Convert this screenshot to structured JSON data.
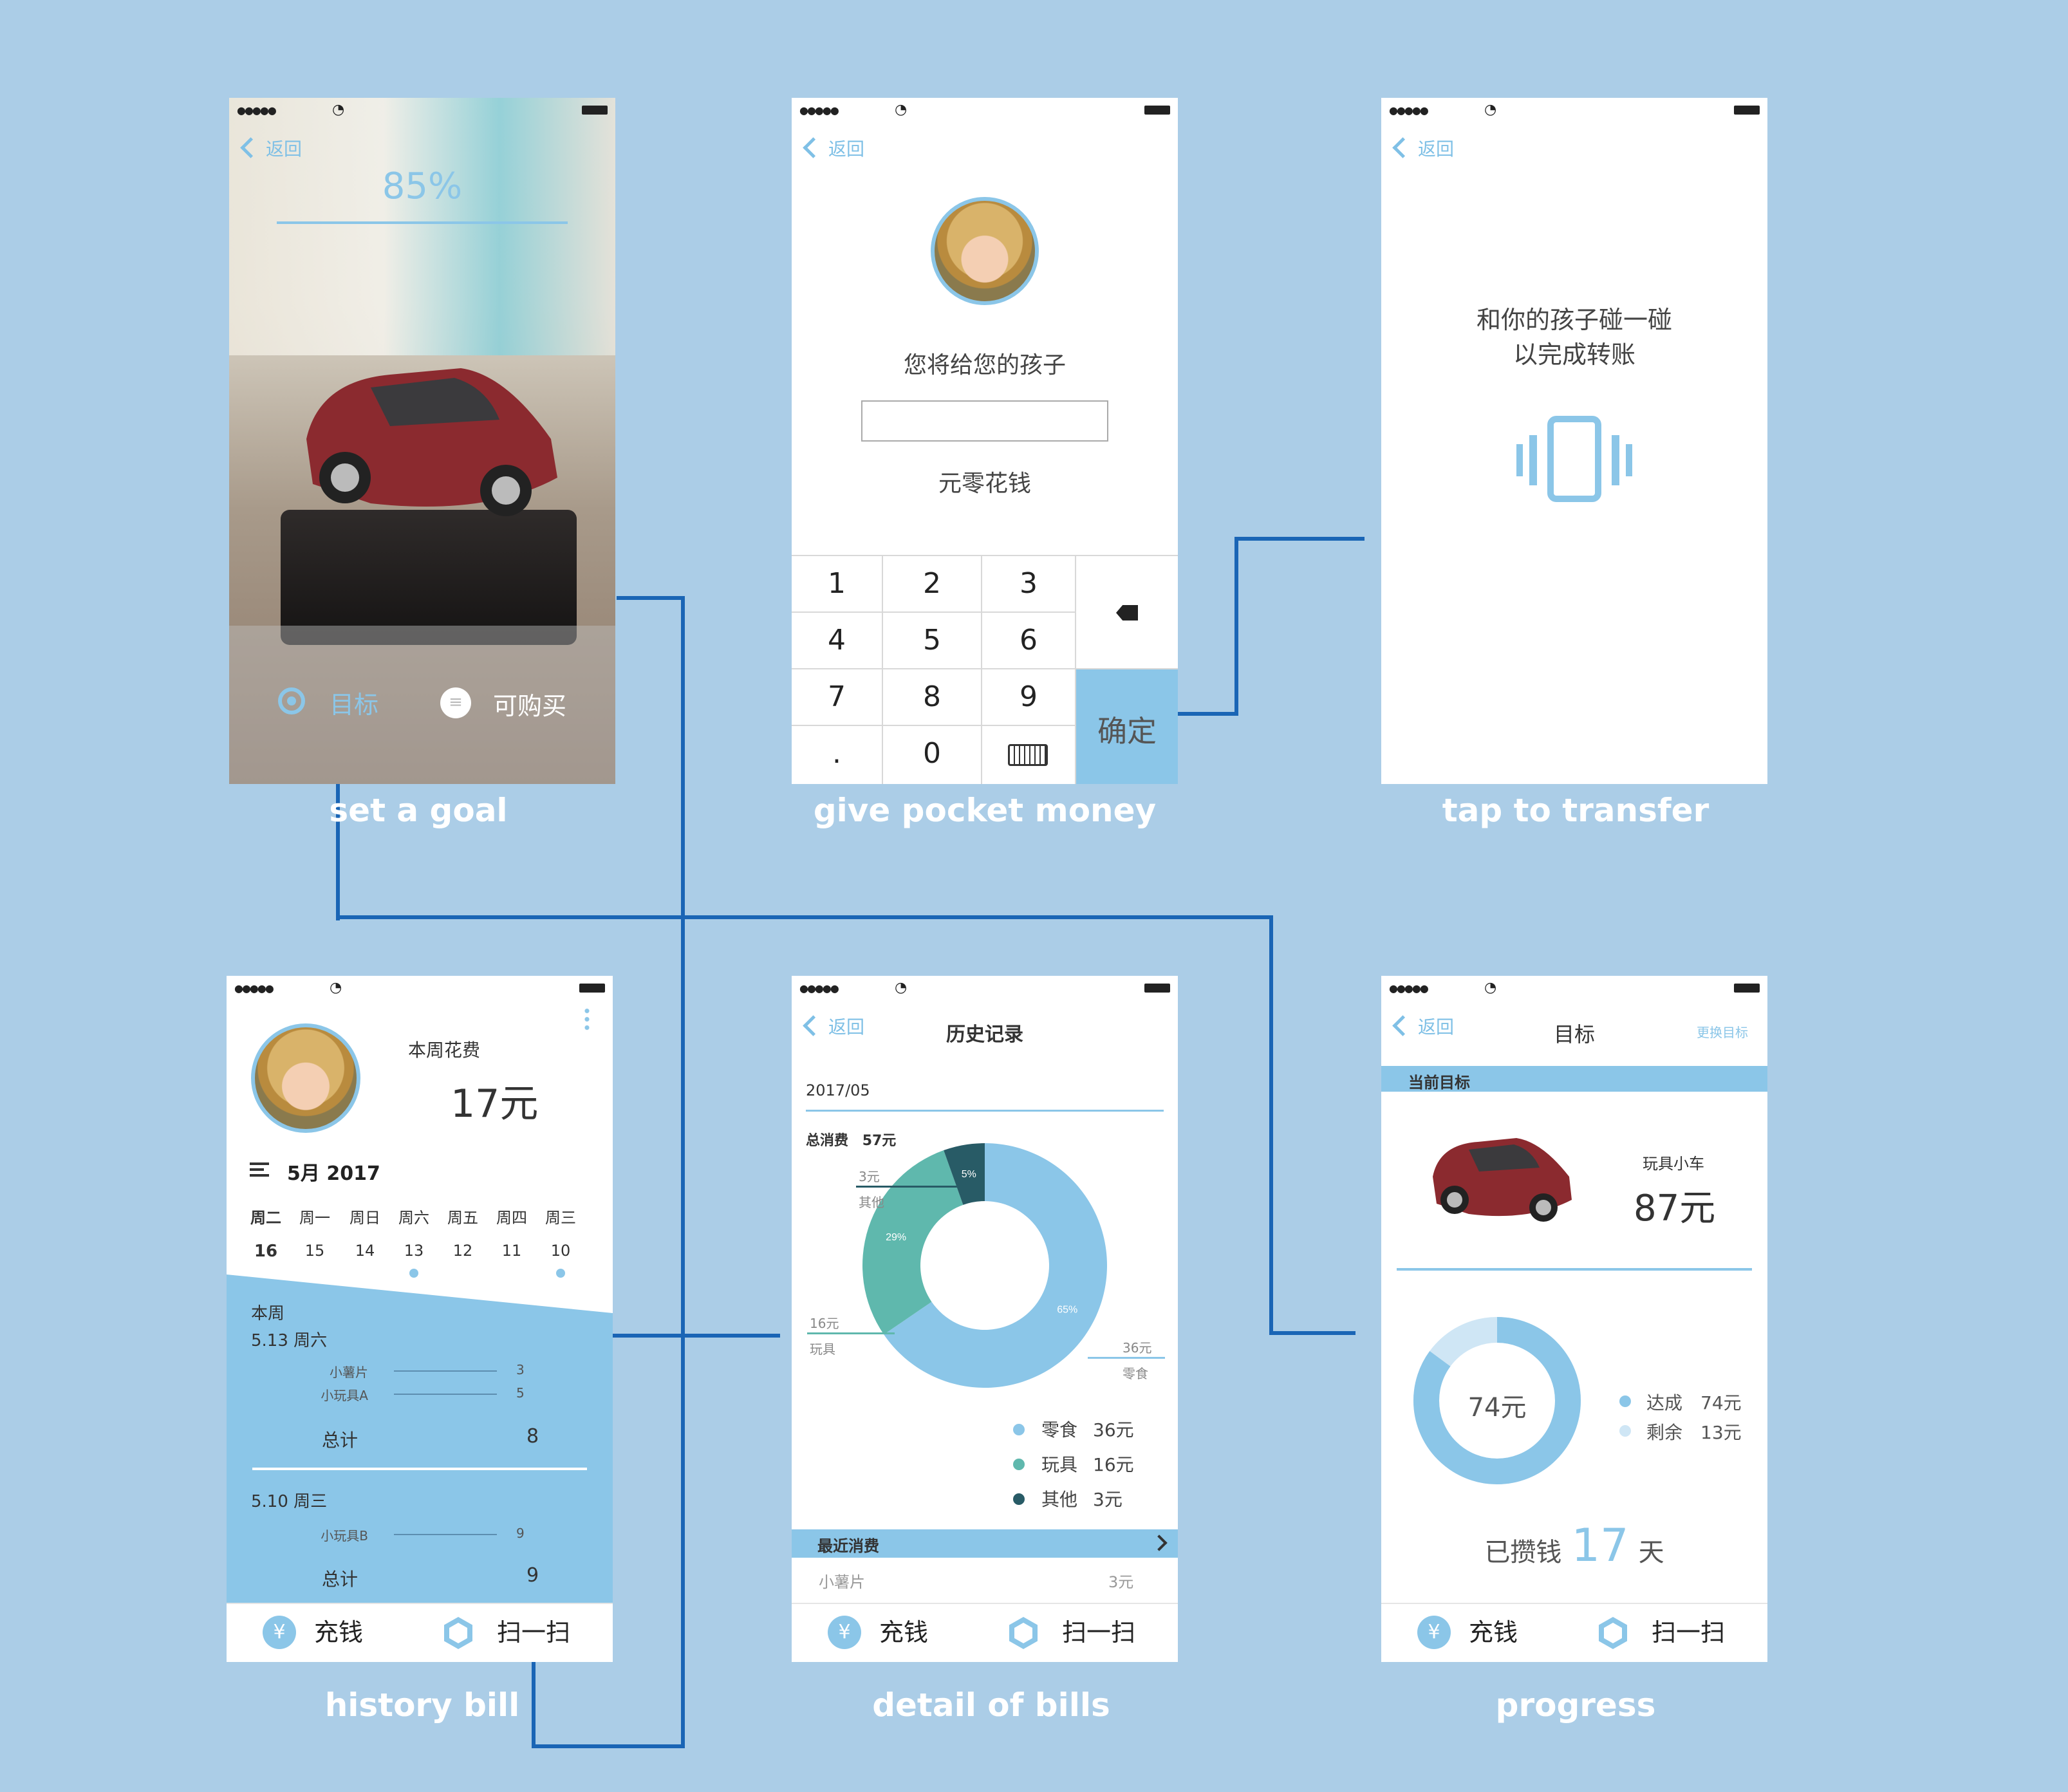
{
  "common": {
    "back_label": "返回",
    "tab_charge": "充钱",
    "tab_scan": "扫一扫",
    "accent": "#8bc6e8",
    "connector": "#1a65b5",
    "background": "#abcde7"
  },
  "captions": {
    "goal": "set a goal",
    "money": "give pocket money",
    "transfer": "tap to transfer",
    "history": "history bill",
    "detail": "detail of bills",
    "progress": "progress"
  },
  "screen_goal": {
    "percent": "85%",
    "tab_target": "目标",
    "tab_buy": "可购买",
    "icons": [
      "target-icon",
      "list-icon"
    ]
  },
  "screen_money": {
    "prompt": "您将给您的孩子",
    "amount_value": "",
    "suffix": "元零花钱",
    "keys": [
      "1",
      "2",
      "3",
      "4",
      "5",
      "6",
      "7",
      "8",
      "9",
      ".",
      "0"
    ],
    "confirm": "确定"
  },
  "screen_transfer": {
    "line1": "和你的孩子碰一碰",
    "line2": "以完成转账"
  },
  "screen_history": {
    "week_spend_label": "本周花费",
    "week_spend_value": "17元",
    "month_label": "5月 2017",
    "days": [
      {
        "name": "周二",
        "num": "16",
        "dot": false
      },
      {
        "name": "周一",
        "num": "15",
        "dot": false
      },
      {
        "name": "周日",
        "num": "14",
        "dot": false
      },
      {
        "name": "周六",
        "num": "13",
        "dot": true
      },
      {
        "name": "周五",
        "num": "12",
        "dot": false
      },
      {
        "name": "周四",
        "num": "11",
        "dot": false
      },
      {
        "name": "周三",
        "num": "10",
        "dot": true
      }
    ],
    "this_week": "本周",
    "entry1": {
      "date": "5.13 周六",
      "items": [
        {
          "name": "小薯片",
          "value": "3"
        },
        {
          "name": "小玩具A",
          "value": "5"
        }
      ],
      "total_label": "总计",
      "total": "8"
    },
    "entry2": {
      "date": "5.10 周三",
      "items": [
        {
          "name": "小玩具B",
          "value": "9"
        }
      ],
      "total_label": "总计",
      "total": "9"
    }
  },
  "screen_detail": {
    "title": "历史记录",
    "month": "2017/05",
    "total_label": "总消费",
    "total_value": "57元",
    "recent_label": "最近消费",
    "recent_item": "小薯片",
    "recent_value": "3元",
    "callouts": {
      "other_value": "3元",
      "other_name": "其他",
      "toy_value": "16元",
      "toy_name": "玩具",
      "snack_value": "36元",
      "snack_name": "零食"
    },
    "legend": [
      {
        "name": "零食",
        "value": "36元",
        "color": "#8bc6e8"
      },
      {
        "name": "玩具",
        "value": "16元",
        "color": "#5fb8ad"
      },
      {
        "name": "其他",
        "value": "3元",
        "color": "#285b66"
      }
    ]
  },
  "chart_data": {
    "type": "pie",
    "categories": [
      "零食",
      "玩具",
      "其他"
    ],
    "values": [
      36,
      16,
      3
    ],
    "percent_labels": [
      "65%",
      "29%",
      "5%"
    ],
    "colors": [
      "#8bc6e8",
      "#5fb8ad",
      "#285b66"
    ],
    "donut": true
  },
  "screen_progress": {
    "title": "目标",
    "change_goal": "更换目标",
    "current_goal": "当前目标",
    "item_name": "玩具小车",
    "item_price": "87元",
    "center_value": "74元",
    "achieved_label": "达成",
    "achieved_value": "74元",
    "achieved_amount": 74,
    "remaining_label": "剩余",
    "remaining_value": "13元",
    "remaining_amount": 13,
    "saved_prefix": "已攒钱",
    "saved_days": "17",
    "saved_suffix": "天"
  }
}
